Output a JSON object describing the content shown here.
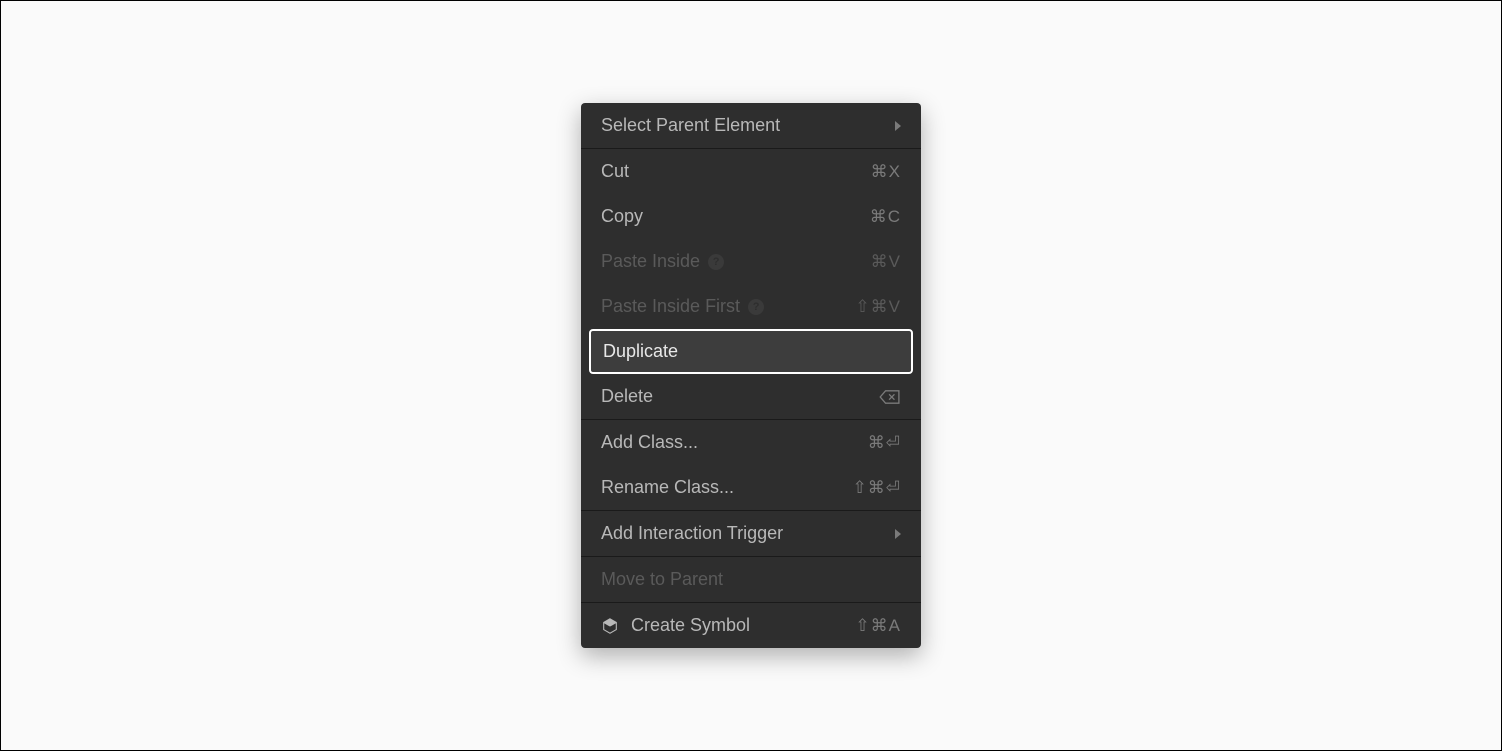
{
  "menu": {
    "selectParent": {
      "label": "Select Parent Element"
    },
    "cut": {
      "label": "Cut",
      "shortcut": "⌘X"
    },
    "copy": {
      "label": "Copy",
      "shortcut": "⌘C"
    },
    "pasteInside": {
      "label": "Paste Inside",
      "shortcut": "⌘V"
    },
    "pasteInsideFirst": {
      "label": "Paste Inside First",
      "shortcut": "⇧⌘V"
    },
    "duplicate": {
      "label": "Duplicate"
    },
    "delete": {
      "label": "Delete"
    },
    "addClass": {
      "label": "Add Class...",
      "shortcut": "⌘⏎"
    },
    "renameClass": {
      "label": "Rename Class...",
      "shortcut": "⇧⌘⏎"
    },
    "addInteraction": {
      "label": "Add Interaction Trigger"
    },
    "moveToParent": {
      "label": "Move to Parent"
    },
    "createSymbol": {
      "label": "Create Symbol",
      "shortcut": "⇧⌘A"
    }
  }
}
